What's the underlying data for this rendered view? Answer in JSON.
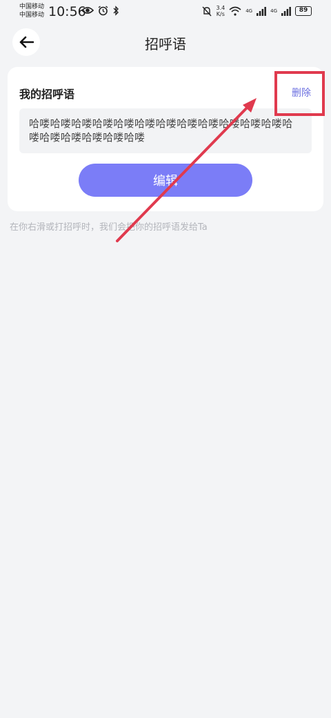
{
  "status_bar": {
    "carrier_1": "中国移动",
    "carrier_2": "中国移动",
    "time": "10:56",
    "speed_value": "3.4",
    "speed_unit": "K/s",
    "net_1": "4G",
    "net_2": "4G",
    "battery": "89"
  },
  "header": {
    "title": "招呼语"
  },
  "card": {
    "title": "我的招呼语",
    "delete_label": "删除",
    "greeting_text": "哈喽哈喽哈喽哈喽哈喽哈喽哈喽哈喽哈喽哈喽哈喽哈喽哈喽哈喽哈喽哈喽哈喽哈喽",
    "edit_label": "编辑"
  },
  "hint": "在你右滑或打招呼时，我们会把你的招呼语发给Ta",
  "colors": {
    "accent": "#7b7df7",
    "delete": "#6b6fe0",
    "annotation": "#e03a4e",
    "background": "#f3f4f6"
  }
}
